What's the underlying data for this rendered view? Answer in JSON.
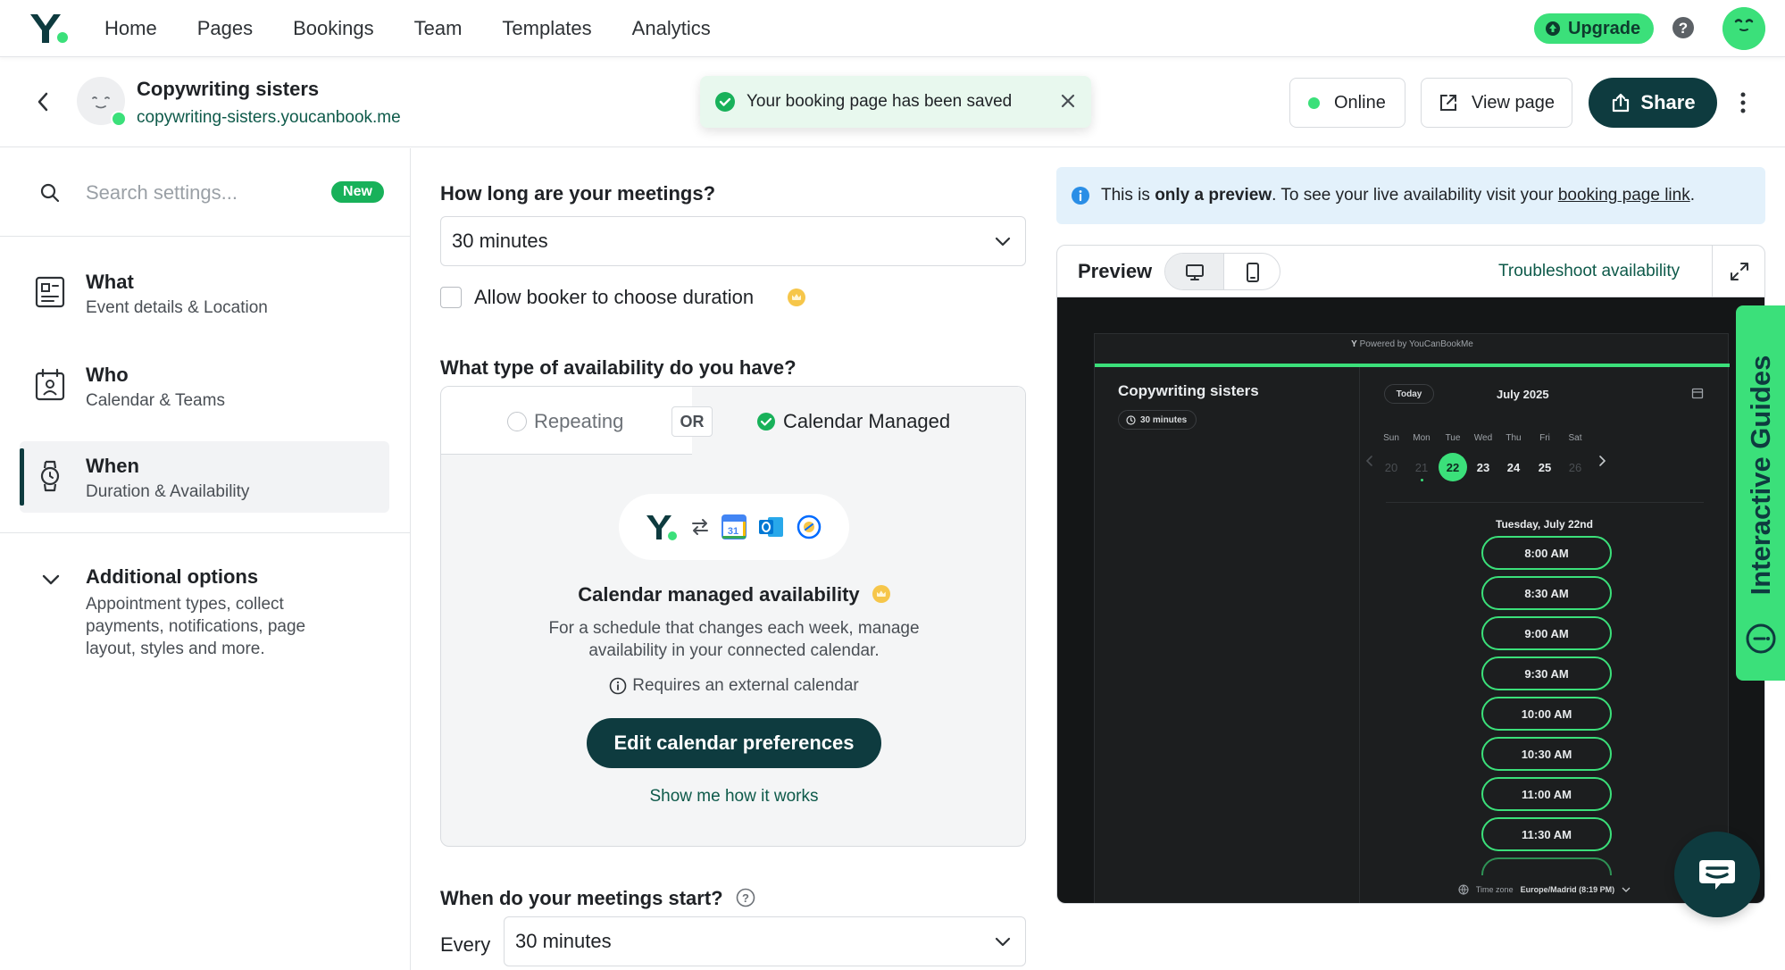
{
  "nav": {
    "links": [
      "Home",
      "Pages",
      "Bookings",
      "Team",
      "Templates",
      "Analytics"
    ],
    "upgrade_label": "Upgrade"
  },
  "header": {
    "page_name": "Copywriting sisters",
    "page_url": "copywriting-sisters.youcanbook.me",
    "toast": "Your booking page has been saved",
    "status_label": "Online",
    "view_label": "View page",
    "share_label": "Share"
  },
  "sidebar": {
    "search_placeholder": "Search settings...",
    "new_badge": "New",
    "items": [
      {
        "title": "What",
        "subtitle": "Event details & Location"
      },
      {
        "title": "Who",
        "subtitle": "Calendar & Teams"
      },
      {
        "title": "When",
        "subtitle": "Duration & Availability"
      }
    ],
    "additional": {
      "title": "Additional options",
      "subtitle": "Appointment types, collect payments, notifications, page layout, styles and more."
    }
  },
  "form": {
    "duration_label": "How long are your meetings?",
    "duration_value": "30 minutes",
    "allow_label": "Allow booker to choose duration",
    "availability_label": "What type of availability do you have?",
    "tab_repeating": "Repeating",
    "or_label": "OR",
    "tab_managed": "Calendar Managed",
    "managed_title": "Calendar managed availability",
    "managed_desc": "For a schedule that changes each week, manage availability in your connected calendar.",
    "requires": "Requires an external calendar",
    "edit_button": "Edit calendar preferences",
    "show_link": "Show me how it works",
    "start_label": "When do your meetings start?",
    "every_label": "Every",
    "every_value": "30 minutes"
  },
  "preview": {
    "banner_prefix": "This is ",
    "banner_bold": "only a preview",
    "banner_mid": ". To see your live availability visit your ",
    "banner_link": "booking page link",
    "banner_end": ".",
    "title": "Preview",
    "troubleshoot": "Troubleshoot availability",
    "booking": {
      "powered": "Powered by YouCanBookMe",
      "name": "Copywriting sisters",
      "duration": "30 minutes",
      "today": "Today",
      "month": "July 2025",
      "days": [
        {
          "h": "Sun",
          "n": "20"
        },
        {
          "h": "Mon",
          "n": "21"
        },
        {
          "h": "Tue",
          "n": "22"
        },
        {
          "h": "Wed",
          "n": "23"
        },
        {
          "h": "Thu",
          "n": "24"
        },
        {
          "h": "Fri",
          "n": "25"
        },
        {
          "h": "Sat",
          "n": "26"
        }
      ],
      "selected_date": "Tuesday, July 22nd",
      "slots": [
        "8:00 AM",
        "8:30 AM",
        "9:00 AM",
        "9:30 AM",
        "10:00 AM",
        "10:30 AM",
        "11:00 AM",
        "11:30 AM"
      ],
      "timezone_label": "Time zone",
      "timezone_value": "Europe/Madrid (8:19 PM)"
    }
  },
  "guides_label": "Interactive Guides",
  "colors": {
    "brand_green": "#3be07a",
    "brand_dark": "#0e3b3f",
    "link": "#0e5a4a"
  }
}
